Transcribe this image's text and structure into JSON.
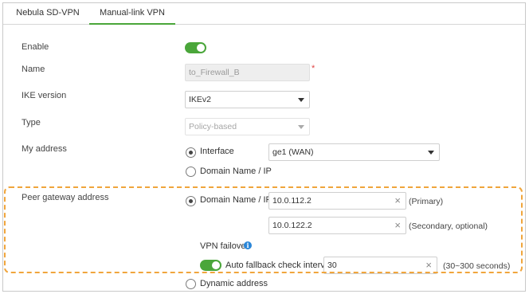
{
  "tabs": [
    {
      "label": "Nebula SD-VPN",
      "active": false
    },
    {
      "label": "Manual-link VPN",
      "active": true
    }
  ],
  "accent_color": "#4aa63a",
  "highlight_color": "#f0a53c",
  "form": {
    "enable": {
      "label": "Enable",
      "on": true
    },
    "name": {
      "label": "Name",
      "value": "to_Firewall_B",
      "required_mark": "*"
    },
    "ike_version": {
      "label": "IKE version",
      "value": "IKEv2"
    },
    "type": {
      "label": "Type",
      "value": "Policy-based"
    },
    "my_address": {
      "label": "My address",
      "option_interface": "Interface",
      "interface_value": "ge1 (WAN)",
      "option_domain": "Domain Name / IP",
      "selected": "Interface"
    },
    "peer_gateway": {
      "label": "Peer gateway address",
      "option_domain": "Domain Name / IP",
      "selected": "Domain Name / IP",
      "primary_value": "10.0.112.2",
      "primary_note": "(Primary)",
      "secondary_value": "10.0.122.2",
      "secondary_note": "(Secondary, optional)",
      "failover_label": "VPN failover",
      "fallback_on": true,
      "fallback_label": "Auto fallback check interval",
      "fallback_value": "30",
      "fallback_note": "(30~300 seconds)",
      "option_dynamic": "Dynamic address"
    }
  }
}
